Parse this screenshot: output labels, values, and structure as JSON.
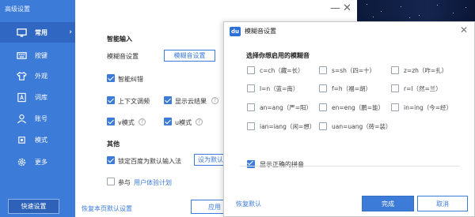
{
  "sidebar": {
    "title": "高级设置",
    "items": [
      {
        "label": "常用",
        "icon": "monitor-icon",
        "active": true
      },
      {
        "label": "按键",
        "icon": "keyboard-icon"
      },
      {
        "label": "外观",
        "icon": "shirt-icon"
      },
      {
        "label": "词库",
        "icon": "dictionary-icon"
      },
      {
        "label": "账号",
        "icon": "person-icon"
      },
      {
        "label": "模式",
        "icon": "mode-icon"
      },
      {
        "label": "更多",
        "icon": "gear-icon"
      }
    ],
    "quick_settings": "快速设置"
  },
  "main": {
    "smart_input": {
      "title": "智能输入",
      "fuzzy_label": "模糊音设置",
      "fuzzy_button": "模糊音设置",
      "smart_correct": "智能纠错",
      "context_adjust": "上下文调频",
      "cloud_result": "显示云结果",
      "v_mode": "v模式",
      "u_mode": "u模式"
    },
    "other": {
      "title": "其他",
      "lock_default": "锁定百度为默认输入法",
      "set_default": "设为默认",
      "join": "参与",
      "ux_plan": "用户体验计划"
    },
    "restore_page": "恢复本页默认设置",
    "apply": "应用"
  },
  "dialog": {
    "title": "模糊音设置",
    "heading": "选择你想启用的模糊音",
    "options": [
      {
        "text": "c=ch（藏=长）",
        "checked": false
      },
      {
        "text": "s=sh（四=十）",
        "checked": false
      },
      {
        "text": "z=zh（咋=扎）",
        "checked": false
      },
      {
        "text": "l=n（蓝=南）",
        "checked": false
      },
      {
        "text": "f=h（福=胡）",
        "checked": false
      },
      {
        "text": "r=l（然=兰）",
        "checked": false
      },
      {
        "text": "an=ang（严=阳）",
        "checked": false
      },
      {
        "text": "en=eng（鹏=能）",
        "checked": false
      },
      {
        "text": "in=ing（今=经）",
        "checked": false
      },
      {
        "text": "ian=iang（闲=想）",
        "checked": false
      },
      {
        "text": "uan=uang（砖=装）",
        "checked": false
      }
    ],
    "show_correct_pinyin": "显示正确的拼音",
    "restore_default": "恢复默认",
    "ok": "完成",
    "cancel": "取消"
  },
  "colors": {
    "accent": "#3d7bd8",
    "sidebar_bg": "#3d7bd8",
    "sidebar_active": "#2f67c2"
  }
}
